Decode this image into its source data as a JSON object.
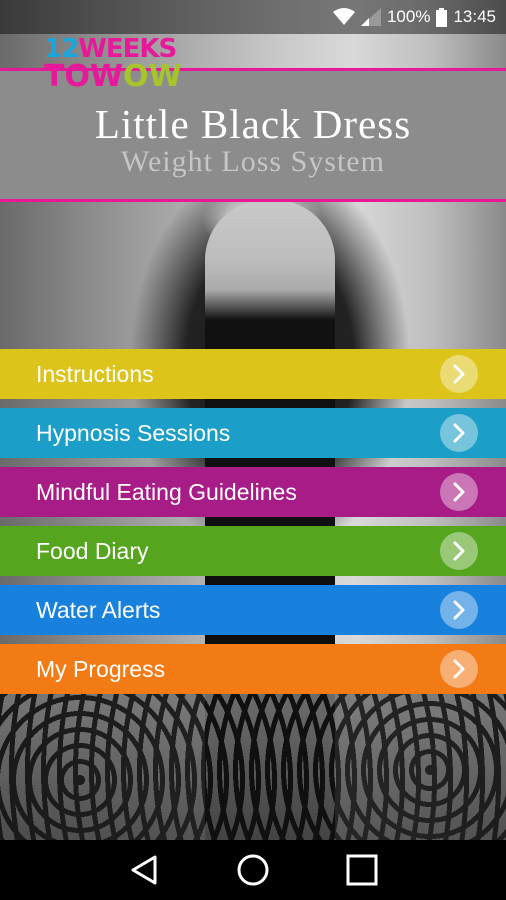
{
  "status_bar": {
    "battery_percent": "100%",
    "time": "13:45",
    "icons": [
      "wifi-icon",
      "signal-icon",
      "battery-icon"
    ]
  },
  "header": {
    "logo": {
      "line1_num": "12",
      "line1_word": "WEEKS",
      "line2_a": "TO",
      "line2_b": "W",
      "line2_c": "O",
      "line2_d": "W"
    },
    "title": "Little Black Dress",
    "subtitle": "Weight Loss System",
    "accent_color": "#e8189a"
  },
  "menu": [
    {
      "label": "Instructions",
      "color": "#dcc41a"
    },
    {
      "label": "Hypnosis Sessions",
      "color": "#1b9ec7"
    },
    {
      "label": "Mindful Eating Guidelines",
      "color": "#a81c87"
    },
    {
      "label": "Food Diary",
      "color": "#56a51f"
    },
    {
      "label": "Water Alerts",
      "color": "#1781dd"
    },
    {
      "label": "My Progress",
      "color": "#f37b16"
    }
  ],
  "nav": [
    "back-icon",
    "home-icon",
    "recents-icon"
  ]
}
